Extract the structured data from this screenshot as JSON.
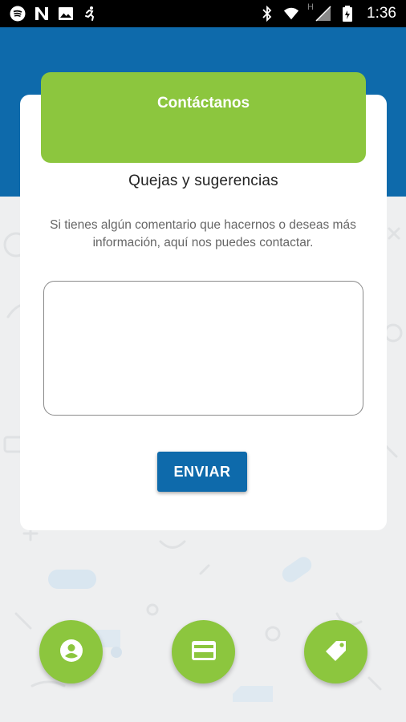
{
  "status_bar": {
    "time": "1:36",
    "left_icons": [
      "spotify-icon",
      "n-app-icon",
      "image-icon",
      "running-icon"
    ],
    "right_icons": [
      "bluetooth-icon",
      "wifi-icon",
      "signal-icon",
      "battery-icon"
    ],
    "network_label": "H"
  },
  "colors": {
    "primary_blue": "#0e6aab",
    "accent_green": "#8cc63e",
    "background": "#eeeff0"
  },
  "contact": {
    "banner_title": "Contáctanos",
    "subtitle": "Quejas y sugerencias",
    "description": "Si tienes algún comentario que hacernos o deseas más información, aquí nos puedes contactar.",
    "message_value": "",
    "send_label": "ENVIAR"
  },
  "bottom_nav": {
    "profile": "account-circle-icon",
    "card": "credit-card-icon",
    "tag": "tag-icon"
  }
}
